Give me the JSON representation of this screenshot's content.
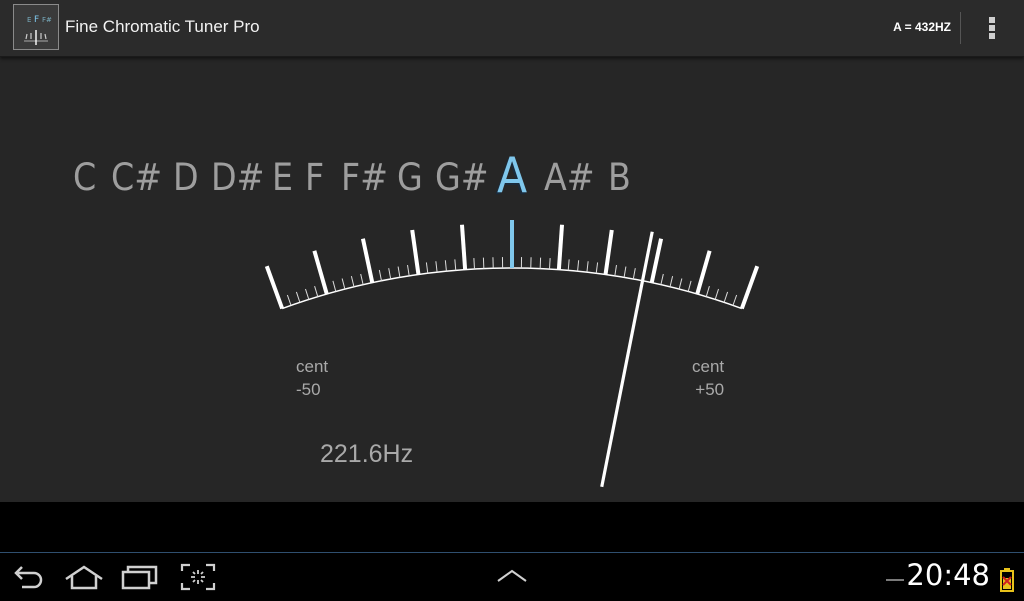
{
  "app": {
    "title": "Fine Chromatic Tuner Pro",
    "icon": "tuner-app-icon",
    "icon_letters": [
      "E",
      "F",
      "F#"
    ]
  },
  "action_bar": {
    "reference_frequency": "A = 432HZ",
    "overflow_icon": "overflow-menu-icon"
  },
  "tuner": {
    "notes": [
      "C",
      "C#",
      "D",
      "D#",
      "E",
      "F",
      "F#",
      "G",
      "G#",
      "A",
      "A#",
      "B"
    ],
    "active_note": "A",
    "scale_min": {
      "label": "cent",
      "value": "-50"
    },
    "scale_max": {
      "label": "cent",
      "value": "+50"
    },
    "needle_cents": 28,
    "frequency": "221.6Hz",
    "accent_color": "#7fc7ec"
  },
  "system_bar": {
    "back_icon": "back-icon",
    "home_icon": "home-icon",
    "recents_icon": "recent-apps-icon",
    "screenshot_icon": "screenshot-icon",
    "menu_up_icon": "chevron-up-icon",
    "clock": "20:48",
    "battery_icon": "battery-icon",
    "status_color": "#e8c21a"
  }
}
